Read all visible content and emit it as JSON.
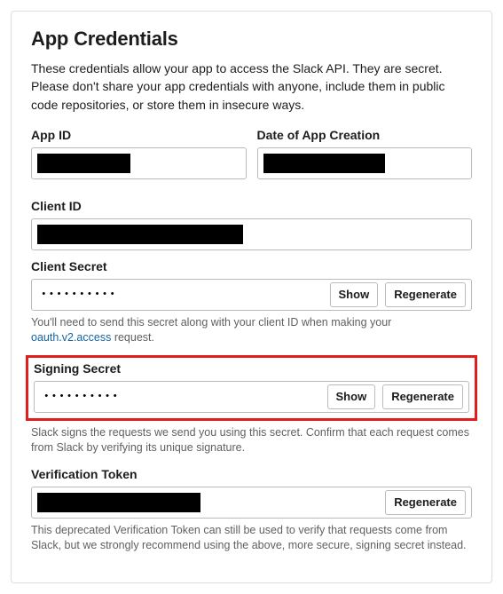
{
  "title": "App Credentials",
  "description": "These credentials allow your app to access the Slack API. They are secret. Please don't share your app credentials with anyone, include them in public code repositories, or store them in insecure ways.",
  "appId": {
    "label": "App ID"
  },
  "dateCreated": {
    "label": "Date of App Creation"
  },
  "clientId": {
    "label": "Client ID"
  },
  "clientSecret": {
    "label": "Client Secret",
    "value": "••••••••••",
    "show": "Show",
    "regenerate": "Regenerate",
    "hint_prefix": "You'll need to send this secret along with your client ID when making your ",
    "hint_link": "oauth.v2.access",
    "hint_suffix": " request."
  },
  "signingSecret": {
    "label": "Signing Secret",
    "value": "••••••••••",
    "show": "Show",
    "regenerate": "Regenerate",
    "hint": "Slack signs the requests we send you using this secret. Confirm that each request comes from Slack by verifying its unique signature."
  },
  "verificationToken": {
    "label": "Verification Token",
    "regenerate": "Regenerate",
    "hint": "This deprecated Verification Token can still be used to verify that requests come from Slack, but we strongly recommend using the above, more secure, signing secret instead."
  }
}
